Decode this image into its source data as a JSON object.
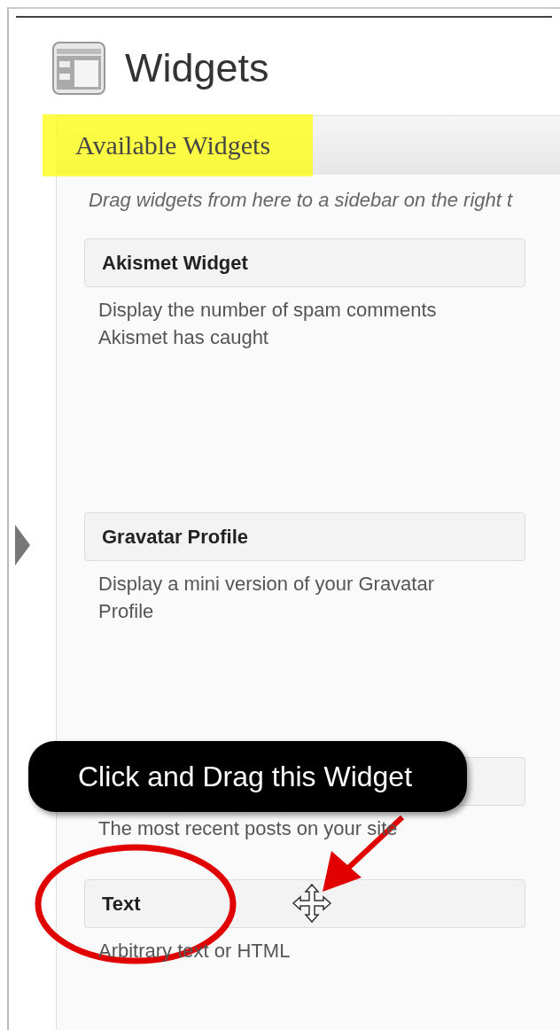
{
  "page": {
    "title": "Widgets"
  },
  "panel": {
    "title": "Available Widgets",
    "highlighted": true,
    "description": "Drag widgets from here to a sidebar on the right t"
  },
  "widgets": [
    {
      "title": "Akismet Widget",
      "description": "Display the number of spam comments Akismet has caught"
    },
    {
      "title": "Gravatar Profile",
      "description": "Display a mini version of your Gravatar Profile"
    },
    {
      "description": "The most recent posts on your site"
    },
    {
      "title": "Text",
      "description": "Arbitrary text or HTML",
      "circled": true
    }
  ],
  "callout": {
    "text": "Click and Drag this Widget"
  }
}
